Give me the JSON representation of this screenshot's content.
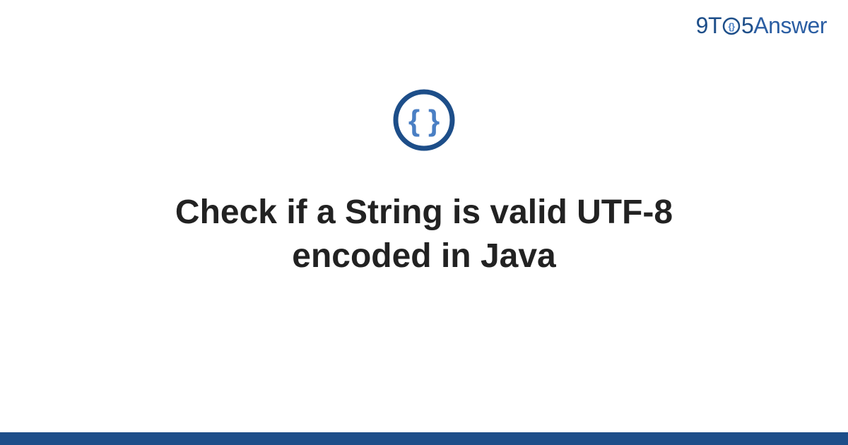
{
  "logo": {
    "part1": "9",
    "part2": "T",
    "part3": "5",
    "part4": "Answer"
  },
  "title": "Check if a String is valid UTF-8 encoded in Java",
  "colors": {
    "brand_dark": "#1d4e89",
    "brand_light": "#4a7fc4",
    "text": "#222222"
  }
}
